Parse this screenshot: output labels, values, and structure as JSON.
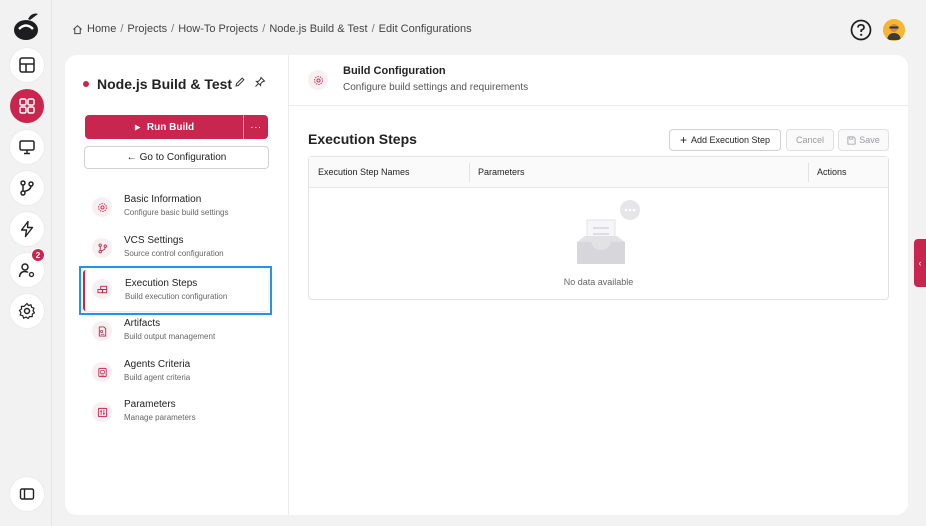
{
  "breadcrumb": [
    "Home",
    "Projects",
    "How-To Projects",
    "Node.js Build & Test",
    "Edit Configurations"
  ],
  "sidebar_rail": {
    "items": [
      {
        "icon": "dashboard-icon"
      },
      {
        "icon": "apps-grid-icon",
        "active": true
      },
      {
        "icon": "monitor-icon"
      },
      {
        "icon": "git-branch-icon"
      },
      {
        "icon": "lightning-icon"
      },
      {
        "icon": "user-settings-icon",
        "badge": "2"
      },
      {
        "icon": "gear-icon"
      }
    ],
    "collapse_icon": "sidebar-toggle-icon"
  },
  "project": {
    "name": "Node.js Build & Test",
    "run_label": "Run Build",
    "more_label": "···",
    "goto_label": "Go to Configuration"
  },
  "nav": [
    {
      "title": "Basic Information",
      "subtitle": "Configure basic build settings",
      "icon": "gear-icon"
    },
    {
      "title": "VCS Settings",
      "subtitle": "Source control configuration",
      "icon": "git-branch-icon"
    },
    {
      "title": "Execution Steps",
      "subtitle": "Build execution configuration",
      "icon": "steps-icon",
      "selected": true
    },
    {
      "title": "Artifacts",
      "subtitle": "Build output management",
      "icon": "file-icon"
    },
    {
      "title": "Agents Criteria",
      "subtitle": "Build agent criteria",
      "icon": "agent-icon"
    },
    {
      "title": "Parameters",
      "subtitle": "Manage parameters",
      "icon": "parameters-icon"
    }
  ],
  "header": {
    "title": "Build Configuration",
    "subtitle": "Configure build settings and requirements"
  },
  "section": {
    "title": "Execution Steps",
    "add_label": "Add Execution Step",
    "cancel_label": "Cancel",
    "save_label": "Save"
  },
  "table": {
    "columns": [
      "Execution Step Names",
      "Parameters",
      "Actions"
    ],
    "rows": [],
    "empty_text": "No data available"
  },
  "colors": {
    "accent": "#c8264e",
    "selection_outline": "#2196e8"
  }
}
